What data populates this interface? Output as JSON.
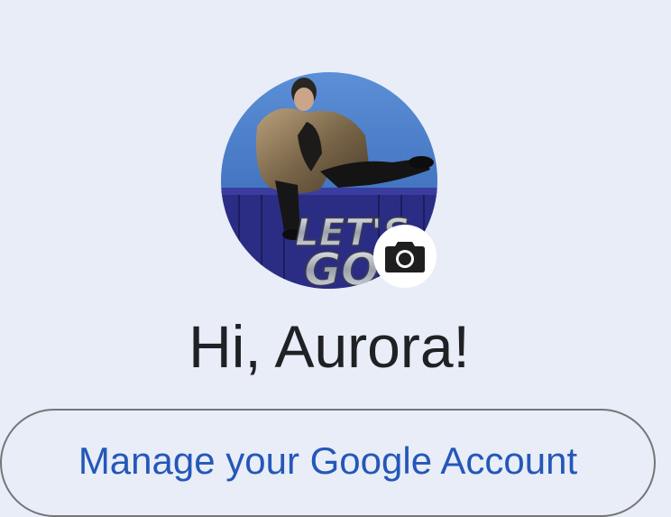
{
  "header": {
    "cut_text": ""
  },
  "profile": {
    "avatar_name": "profile-photo",
    "avatar_text_line1": "LET'S",
    "avatar_text_line2": "GO",
    "camera_icon": "camera-icon"
  },
  "greeting": {
    "text": "Hi, Aurora!"
  },
  "actions": {
    "manage_label": "Manage your Google Account"
  },
  "colors": {
    "background": "#e8edf8",
    "link_blue": "#2557b8",
    "outline": "#747775"
  }
}
